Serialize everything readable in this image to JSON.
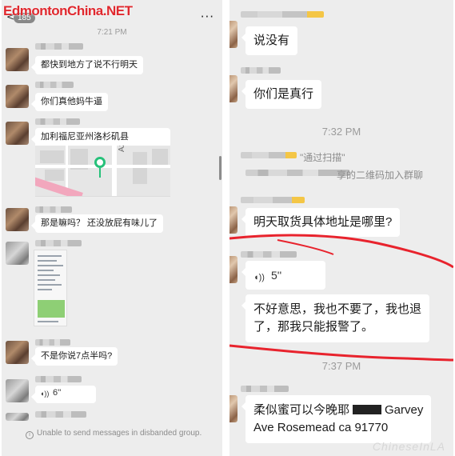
{
  "logo": "EdmontonChina.NET",
  "left": {
    "header": {
      "back": "<",
      "badge": "185",
      "more": "···"
    },
    "time1": "7:21 PM",
    "msgs": {
      "m1": "都快到地方了说不行明天",
      "m2": "你们真他妈牛逼",
      "m3": "加利福尼亚州洛杉矶县",
      "m4": "那是嘛吗？ 还没放屁有味儿了",
      "m5": "不是你说7点半吗?"
    },
    "map": {
      "street": "Azusa Ave"
    },
    "voice": {
      "icon": "◖))",
      "duration": "6''"
    },
    "system": {
      "icon": "i",
      "text": "Unable to send messages in disbanded group."
    }
  },
  "right": {
    "msgs": {
      "r1": "说没有",
      "r2": "你们是真行",
      "r3": "明天取货具体地址是哪里?",
      "r4a": "不好意思，我也不要了，我也退",
      "r4b": "了，那我只能报警了。",
      "r5a": "柔似蜜可以今晚耶",
      "r5b": "Garvey",
      "r5c": "Ave Rosemead  ca 91770"
    },
    "time2": "7:32 PM",
    "time3": "7:37 PM",
    "join": {
      "a": "\"通过扫描\"",
      "b": "享的二维码加入群聊"
    },
    "voice": {
      "icon": "◖))",
      "duration": "5''"
    },
    "watermark": "ChineseInLA"
  },
  "colors": {
    "chat_bg": "#ededed",
    "bubble": "#ffffff",
    "annotation": "#e8232d",
    "logo": "#e0282e"
  }
}
